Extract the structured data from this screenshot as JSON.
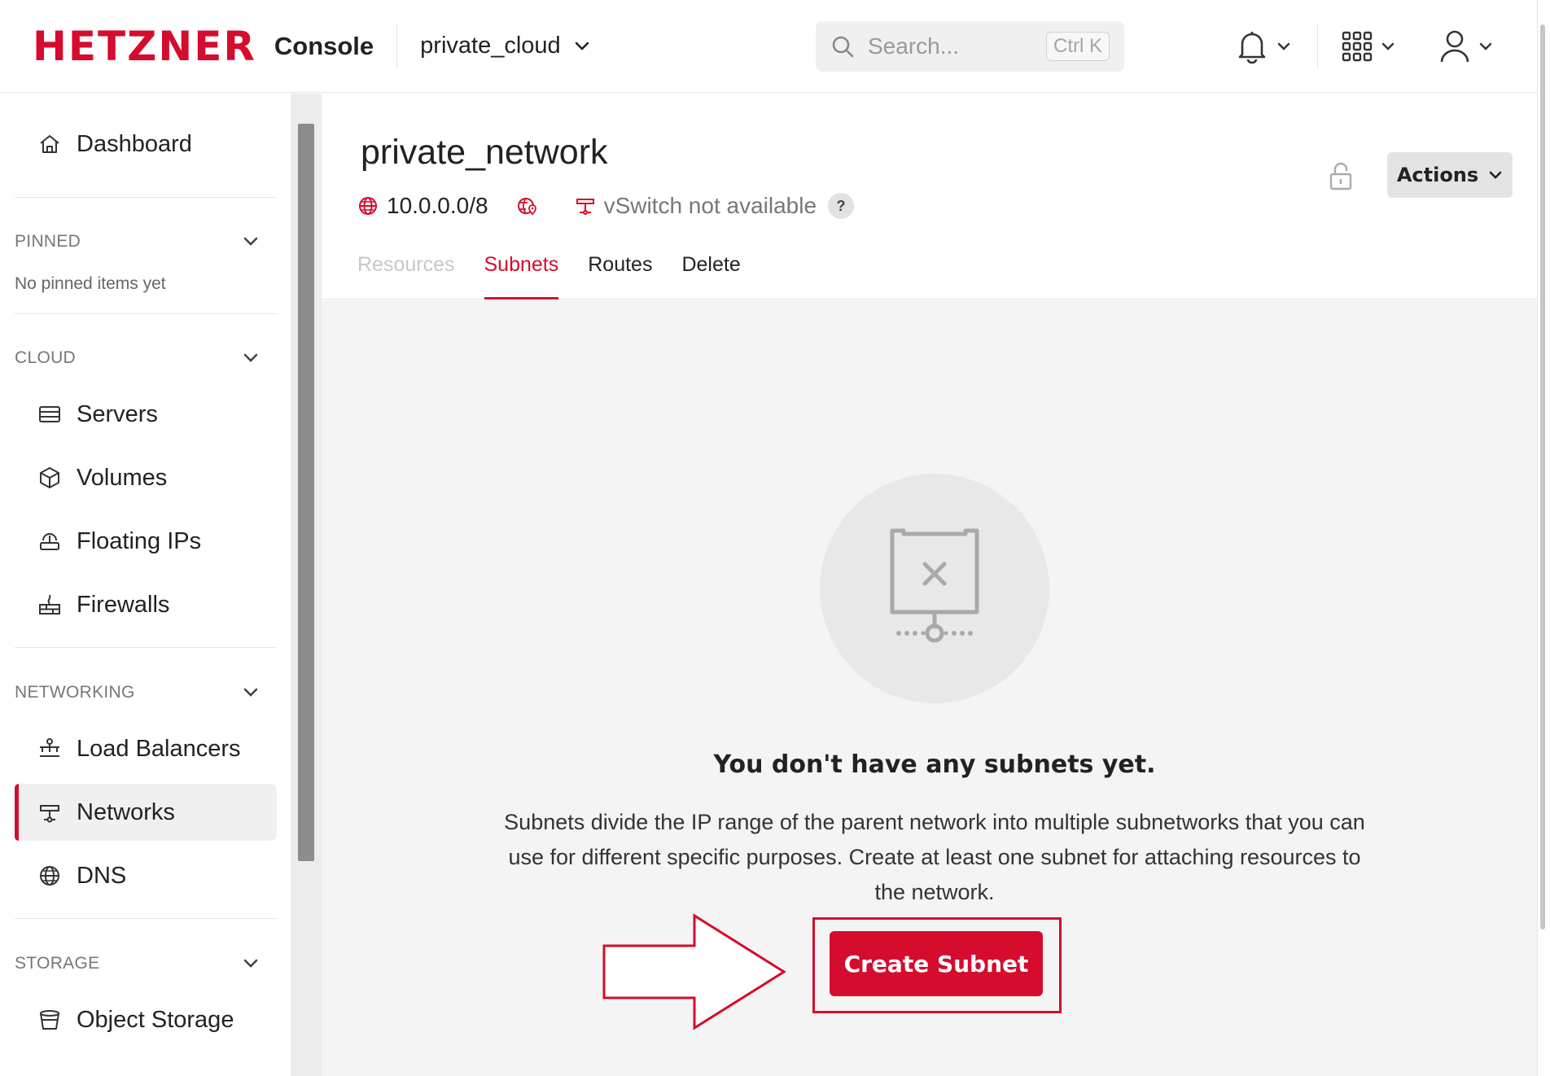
{
  "header": {
    "logo": "HETZNER",
    "console": "Console",
    "project": "private_cloud",
    "search_placeholder": "Search...",
    "search_shortcut": "Ctrl K"
  },
  "sidebar": {
    "dashboard": "Dashboard",
    "pinned_heading": "PINNED",
    "pinned_empty": "No pinned items yet",
    "cloud_heading": "CLOUD",
    "cloud_items": [
      "Servers",
      "Volumes",
      "Floating IPs",
      "Firewalls"
    ],
    "networking_heading": "NETWORKING",
    "networking_items": [
      "Load Balancers",
      "Networks",
      "DNS"
    ],
    "storage_heading": "STORAGE",
    "storage_items": [
      "Object Storage"
    ]
  },
  "network": {
    "title": "private_network",
    "ip_range": "10.0.0.0/8",
    "vswitch": "vSwitch not available",
    "help": "?",
    "actions_label": "Actions"
  },
  "tabs": [
    "Resources",
    "Subnets",
    "Routes",
    "Delete"
  ],
  "empty_state": {
    "title": "You don't have any subnets yet.",
    "description": "Subnets divide the IP range of the parent network into multiple subnetworks that you can use for different specific purposes. Create at least one subnet for attaching resources to the network.",
    "button": "Create Subnet"
  },
  "colors": {
    "brand": "#d50c2d",
    "active_bg": "#f0f0f0",
    "body_bg": "#f4f4f4"
  }
}
